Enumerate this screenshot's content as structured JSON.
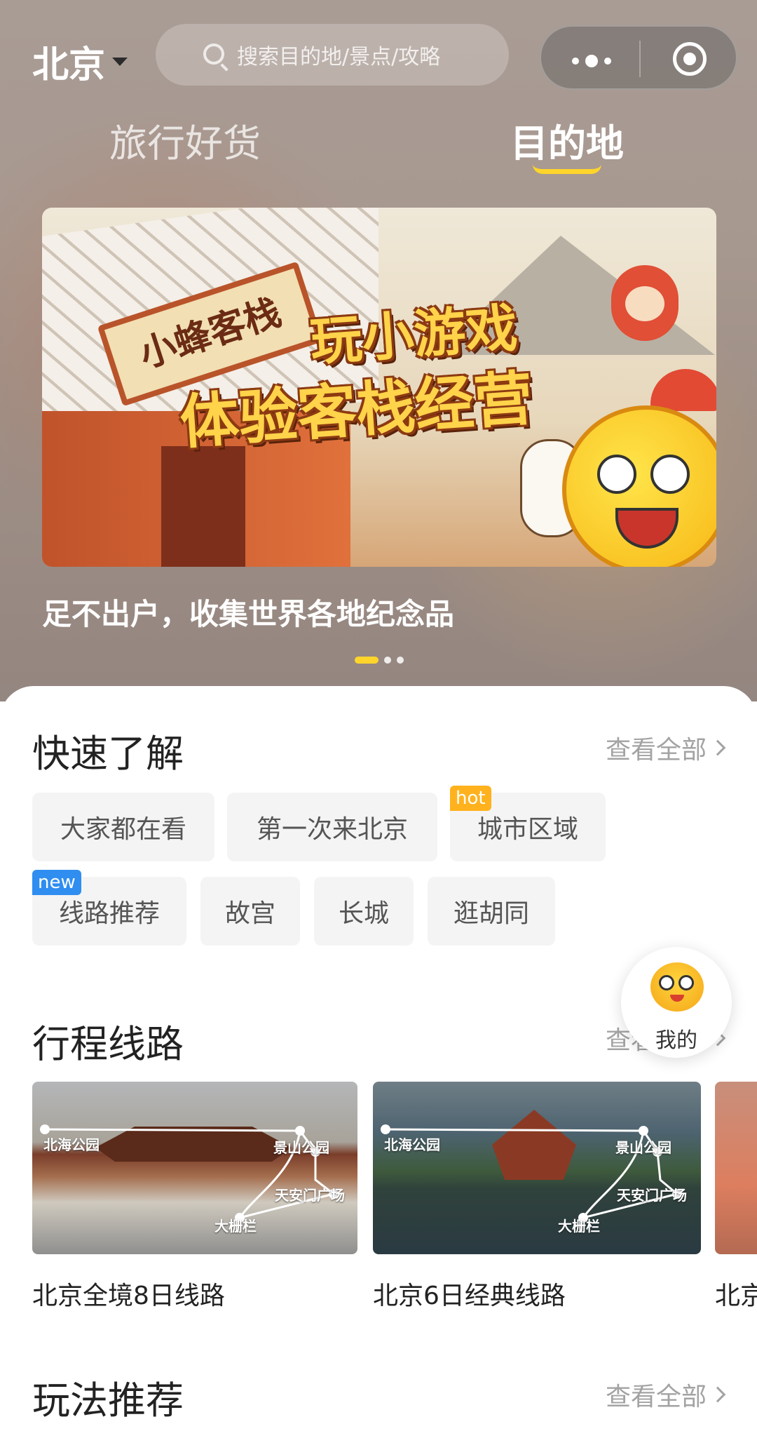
{
  "header": {
    "city": "北京",
    "search_placeholder": "搜索目的地/景点/攻略"
  },
  "tabs": [
    {
      "label": "旅行好货",
      "active": false
    },
    {
      "label": "目的地",
      "active": true
    }
  ],
  "banner": {
    "sign_text": "小蜂客栈",
    "title_line1": "玩小游戏",
    "title_line2": "体验客栈经营",
    "caption": "足不出户，收集世界各地纪念品",
    "slide_count": 3,
    "active_slide": 1
  },
  "quick": {
    "title": "快速了解",
    "see_all": "查看全部",
    "chips": [
      {
        "label": "大家都在看",
        "badge": ""
      },
      {
        "label": "第一次来北京",
        "badge": ""
      },
      {
        "label": "城市区域",
        "badge": "hot"
      },
      {
        "label": "线路推荐",
        "badge": "new"
      },
      {
        "label": "故宫",
        "badge": ""
      },
      {
        "label": "长城",
        "badge": ""
      },
      {
        "label": "逛胡同",
        "badge": ""
      }
    ]
  },
  "routes": {
    "title": "行程线路",
    "see_all": "查看全部",
    "map_labels": [
      "北海公园",
      "景山公园",
      "天安门广场",
      "大栅栏"
    ],
    "items": [
      {
        "name": "北京全境8日线路"
      },
      {
        "name": "北京6日经典线路"
      },
      {
        "name": "北京"
      }
    ]
  },
  "play": {
    "title": "玩法推荐",
    "see_all": "查看全部"
  },
  "fab": {
    "label": "我的"
  },
  "colors": {
    "accent": "#ffd52b",
    "hot": "#ffb21d",
    "new": "#2f8ef0"
  }
}
